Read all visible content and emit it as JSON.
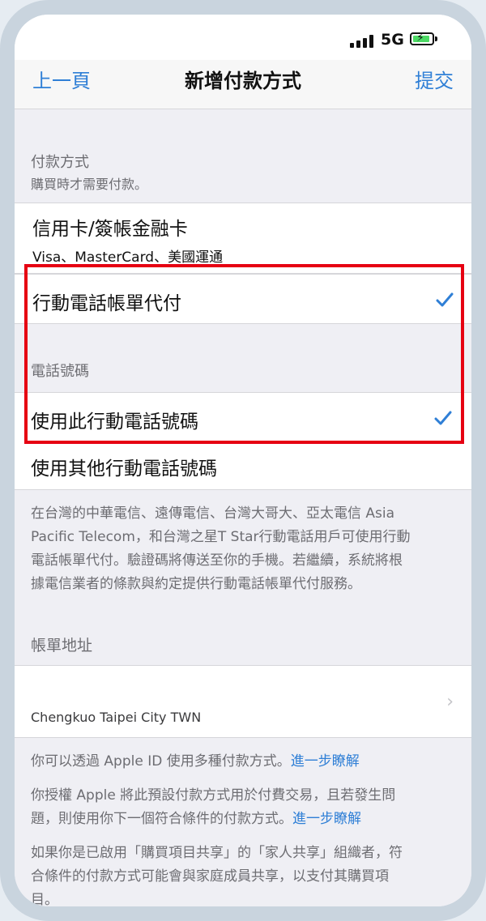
{
  "status_bar": {
    "network": "5G",
    "signal_icon": "signal-bars-icon",
    "battery_icon": "battery-charging-icon"
  },
  "nav": {
    "back": "上一頁",
    "title": "新增付款方式",
    "submit": "提交"
  },
  "payment_section": {
    "header": "付款方式",
    "subheader": "購買時才需要付款。"
  },
  "payment_options": [
    {
      "title": "信用卡/簽帳金融卡",
      "detail": "Visa、MasterCard、美國運通"
    },
    {
      "title": "行動電話帳單代付",
      "selected": true
    }
  ],
  "phone_section": {
    "header": "電話號碼"
  },
  "phone_options": [
    {
      "title": "使用此行動電話號碼",
      "selected": true
    },
    {
      "title": "使用其他行動電話號碼"
    }
  ],
  "carrier_note": {
    "line1": "在台灣的中華電信、遠傳電信、台灣大哥大、亞太電信 Asia",
    "line2": "Pacific Telecom，和台灣之星T Star行動電話用戶可使用行動",
    "line3": "電話帳單代付。驗證碼將傳送至你的手機。若繼續，系統將根",
    "line4": "據電信業者的條款與約定提供行動電話帳單代付服務。"
  },
  "billing_section": {
    "header": "帳單地址",
    "address": "Chengkuo Taipei City TWN"
  },
  "footer": {
    "p1_text": "你可以透過 Apple ID 使用多種付款方式。",
    "p1_link": "進一步瞭解",
    "p2_line1": "你授權 Apple 將此預設付款方式用於付費交易，且若發生問",
    "p2_line2": "題，則使用你下一個符合條件的付款方式。",
    "p2_link": "進一步瞭解",
    "p3_line1": "如果你是已啟用「購買項目共享」的「家人共享」組織者，符",
    "p3_line2": "合條件的付款方式可能會與家庭成員共享，以支付其購買項",
    "p3_line3": "目。"
  },
  "colors": {
    "accent": "#2f7fd6",
    "highlight": "#e60012",
    "background": "#efeff4"
  }
}
